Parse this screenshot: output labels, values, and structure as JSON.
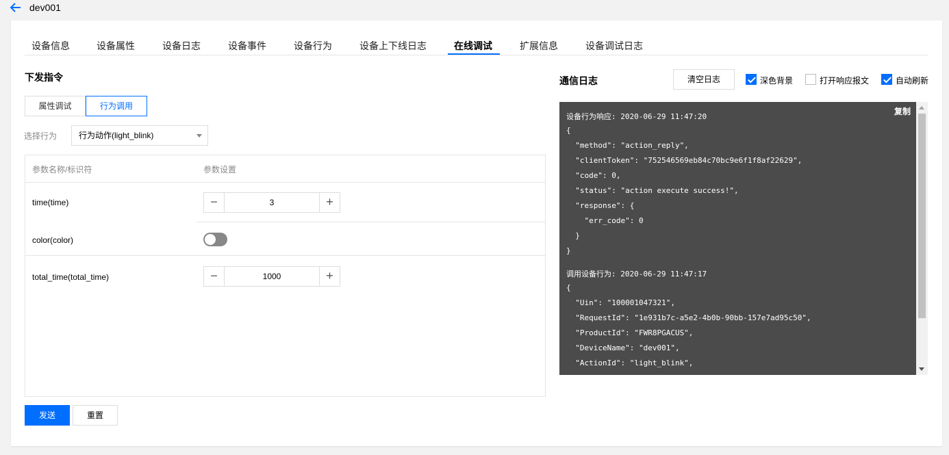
{
  "header": {
    "device_name": "dev001",
    "back_icon": "arrow-left-icon"
  },
  "tabs": [
    {
      "label": "设备信息",
      "active": false
    },
    {
      "label": "设备属性",
      "active": false
    },
    {
      "label": "设备日志",
      "active": false
    },
    {
      "label": "设备事件",
      "active": false
    },
    {
      "label": "设备行为",
      "active": false
    },
    {
      "label": "设备上下线日志",
      "active": false
    },
    {
      "label": "在线调试",
      "active": true
    },
    {
      "label": "扩展信息",
      "active": false
    },
    {
      "label": "设备调试日志",
      "active": false
    }
  ],
  "command": {
    "title": "下发指令",
    "subtabs": [
      {
        "label": "属性调试",
        "active": false
      },
      {
        "label": "行为调用",
        "active": true
      }
    ],
    "select_label": "选择行为",
    "select_value": "行为动作(light_blink)",
    "table": {
      "col_name": "参数名称/标识符",
      "col_setting": "参数设置",
      "rows": [
        {
          "name": "time(time)",
          "type": "stepper",
          "value": "3"
        },
        {
          "name": "color(color)",
          "type": "toggle",
          "on": false
        },
        {
          "name": "total_time(total_time)",
          "type": "stepper",
          "value": "1000"
        }
      ]
    },
    "send_label": "发送",
    "reset_label": "重置"
  },
  "log": {
    "title": "通信日志",
    "clear_label": "清空日志",
    "dark_bg_label": "深色背景",
    "dark_bg_checked": true,
    "show_resp_label": "打开响应报文",
    "show_resp_checked": false,
    "auto_refresh_label": "自动刷新",
    "auto_refresh_checked": true,
    "copy_label": "复制",
    "lines": [
      "设备行为响应: 2020-06-29 11:47:20",
      "{",
      "  \"method\": \"action_reply\",",
      "  \"clientToken\": \"752546569eb84c70bc9e6f1f8af22629\",",
      "  \"code\": 0,",
      "  \"status\": \"action execute success!\",",
      "  \"response\": {",
      "    \"err_code\": 0",
      "  }",
      "}",
      "调用设备行为: 2020-06-29 11:47:17",
      "{",
      "  \"Uin\": \"100001047321\",",
      "  \"RequestId\": \"1e931b7c-a5e2-4b0b-90bb-157e7ad95c50\",",
      "  \"ProductId\": \"FWR8PGACUS\",",
      "  \"DeviceName\": \"dev001\",",
      "  \"ActionId\": \"light_blink\","
    ]
  },
  "colors": {
    "accent": "#006eff",
    "log_bg": "#4b4b4b"
  }
}
